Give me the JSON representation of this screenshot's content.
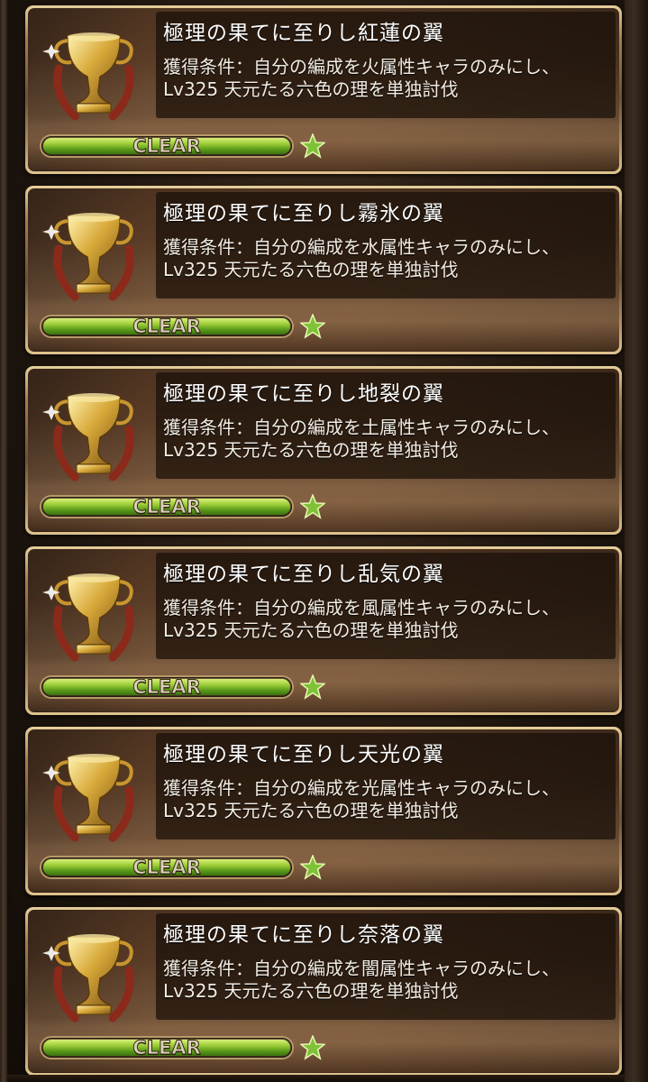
{
  "clear_label": "CLEAR",
  "colors": {
    "accent_gold": "#c9a85c",
    "progress_green": "#8fc43a",
    "star_green": "#7fc23a"
  },
  "icons": {
    "trophy": "gold-trophy-with-laurel-icon",
    "star": "green-star-icon"
  },
  "trophies": [
    {
      "title": "極理の果てに至りし紅蓮の翼",
      "condition_line1": "獲得条件：自分の編成を火属性キャラのみにし、",
      "condition_line2": "Lv325 天元たる六色の理を単独討伐",
      "progress": 1.0,
      "stars": 1
    },
    {
      "title": "極理の果てに至りし霧氷の翼",
      "condition_line1": "獲得条件：自分の編成を水属性キャラのみにし、",
      "condition_line2": "Lv325 天元たる六色の理を単独討伐",
      "progress": 1.0,
      "stars": 1
    },
    {
      "title": "極理の果てに至りし地裂の翼",
      "condition_line1": "獲得条件：自分の編成を土属性キャラのみにし、",
      "condition_line2": "Lv325 天元たる六色の理を単独討伐",
      "progress": 1.0,
      "stars": 1
    },
    {
      "title": "極理の果てに至りし乱気の翼",
      "condition_line1": "獲得条件：自分の編成を風属性キャラのみにし、",
      "condition_line2": "Lv325 天元たる六色の理を単独討伐",
      "progress": 1.0,
      "stars": 1
    },
    {
      "title": "極理の果てに至りし天光の翼",
      "condition_line1": "獲得条件：自分の編成を光属性キャラのみにし、",
      "condition_line2": "Lv325 天元たる六色の理を単独討伐",
      "progress": 1.0,
      "stars": 1
    },
    {
      "title": "極理の果てに至りし奈落の翼",
      "condition_line1": "獲得条件：自分の編成を闇属性キャラのみにし、",
      "condition_line2": "Lv325 天元たる六色の理を単独討伐",
      "progress": 1.0,
      "stars": 1
    }
  ]
}
